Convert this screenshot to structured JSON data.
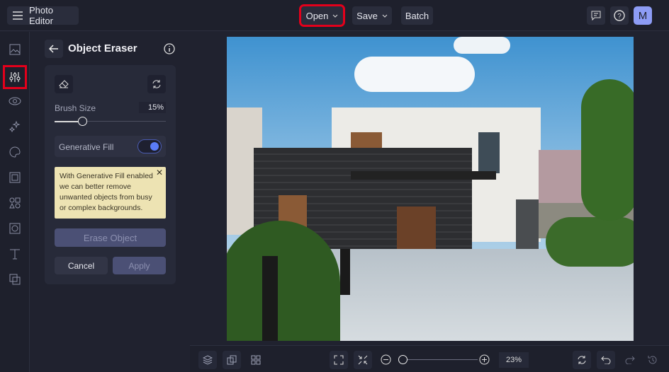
{
  "app": {
    "title": "Photo Editor",
    "avatar": "M"
  },
  "toolbar": {
    "open": "Open",
    "save": "Save",
    "batch": "Batch"
  },
  "panel": {
    "title": "Object Eraser",
    "brush_label": "Brush Size",
    "brush_value": "15%",
    "brush_fraction": 0.15,
    "gen_fill_label": "Generative Fill",
    "gen_fill_on": true,
    "tip": "With Generative Fill enabled we can better remove unwanted objects from busy or complex backgrounds.",
    "erase": "Erase Object",
    "cancel": "Cancel",
    "apply": "Apply"
  },
  "bottom": {
    "zoom_value": "23%",
    "zoom_fraction": 0.0
  },
  "colors": {
    "accent": "#5b7cf6",
    "highlight": "#e3001b",
    "tip_bg": "#ede3b3"
  }
}
